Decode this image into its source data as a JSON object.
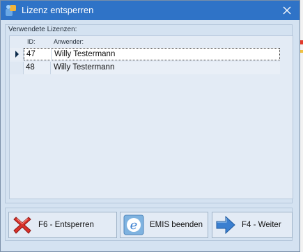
{
  "window": {
    "title": "Lizenz entsperren"
  },
  "group": {
    "label": "Verwendete Lizenzen:"
  },
  "grid": {
    "columns": [
      "ID:",
      "Anwender:"
    ],
    "rows": [
      {
        "id": "47",
        "user": "Willy Testermann",
        "selected": true
      },
      {
        "id": "48",
        "user": "Willy Testermann",
        "selected": false
      }
    ]
  },
  "buttons": {
    "unlock": {
      "label": "F6 - Entsperren",
      "icon": "red-x-icon"
    },
    "emis": {
      "label": "EMIS beenden",
      "icon": "emis-logo-icon"
    },
    "next": {
      "label": "F4 - Weiter",
      "icon": "arrow-right-icon"
    }
  },
  "colors": {
    "titlebar": "#2f73c7",
    "window_bg": "#d4e2f1",
    "grid_bg": "#e3ebf5",
    "accent_red": "#d9322b",
    "accent_blue": "#3a7fd0"
  }
}
